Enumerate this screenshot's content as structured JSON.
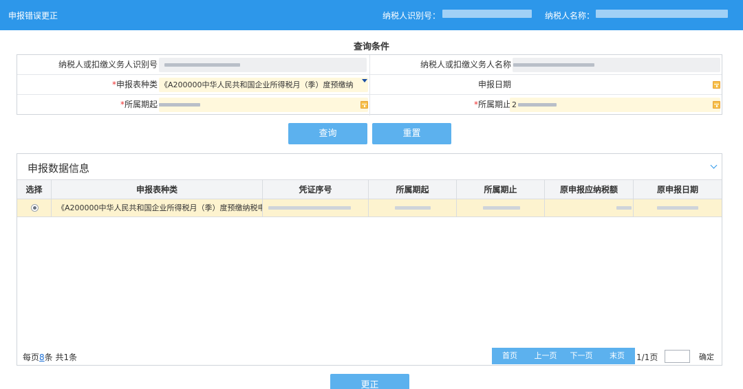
{
  "topbar": {
    "title": "申报错误更正",
    "taxpayer_id_label": "纳税人识别号：",
    "taxpayer_name_label": "纳税人名称："
  },
  "query": {
    "section_title": "查询条件",
    "fields": {
      "agent_id_label": "纳税人或扣缴义务人识别号",
      "agent_name_label": "纳税人或扣缴义务人名称",
      "form_type_label": "申报表种类",
      "form_type_value": "《A200000中华人民共和国企业所得税月（季）度预缴纳",
      "declare_date_label": "申报日期",
      "period_start_label": "所属期起",
      "period_end_label": "所属期止",
      "period_end_prefix": "2"
    },
    "required_mark": "*",
    "query_button": "查询",
    "reset_button": "重置"
  },
  "results": {
    "title": "申报数据信息",
    "columns": [
      "选择",
      "申报表种类",
      "凭证序号",
      "所属期起",
      "所属期止",
      "原申报应纳税额",
      "原申报日期"
    ],
    "rows": [
      {
        "form_type": "《A200000中华人民共和国企业所得税月（季）度预缴纳税申...",
        "selected": true
      }
    ],
    "pager": {
      "per_page_prefix": "每页",
      "per_page_value": "8",
      "per_page_suffix": "条 共1条",
      "first": "首页",
      "prev": "上一页",
      "next": "下一页",
      "last": "末页",
      "page_status": "1/1页",
      "confirm": "确定"
    }
  },
  "footer": {
    "correct_button": "更正"
  },
  "colors": {
    "topbar": "#2d97ea",
    "button": "#5cb1ee",
    "selected_row": "#fdf3cf",
    "required": "#e33333"
  }
}
